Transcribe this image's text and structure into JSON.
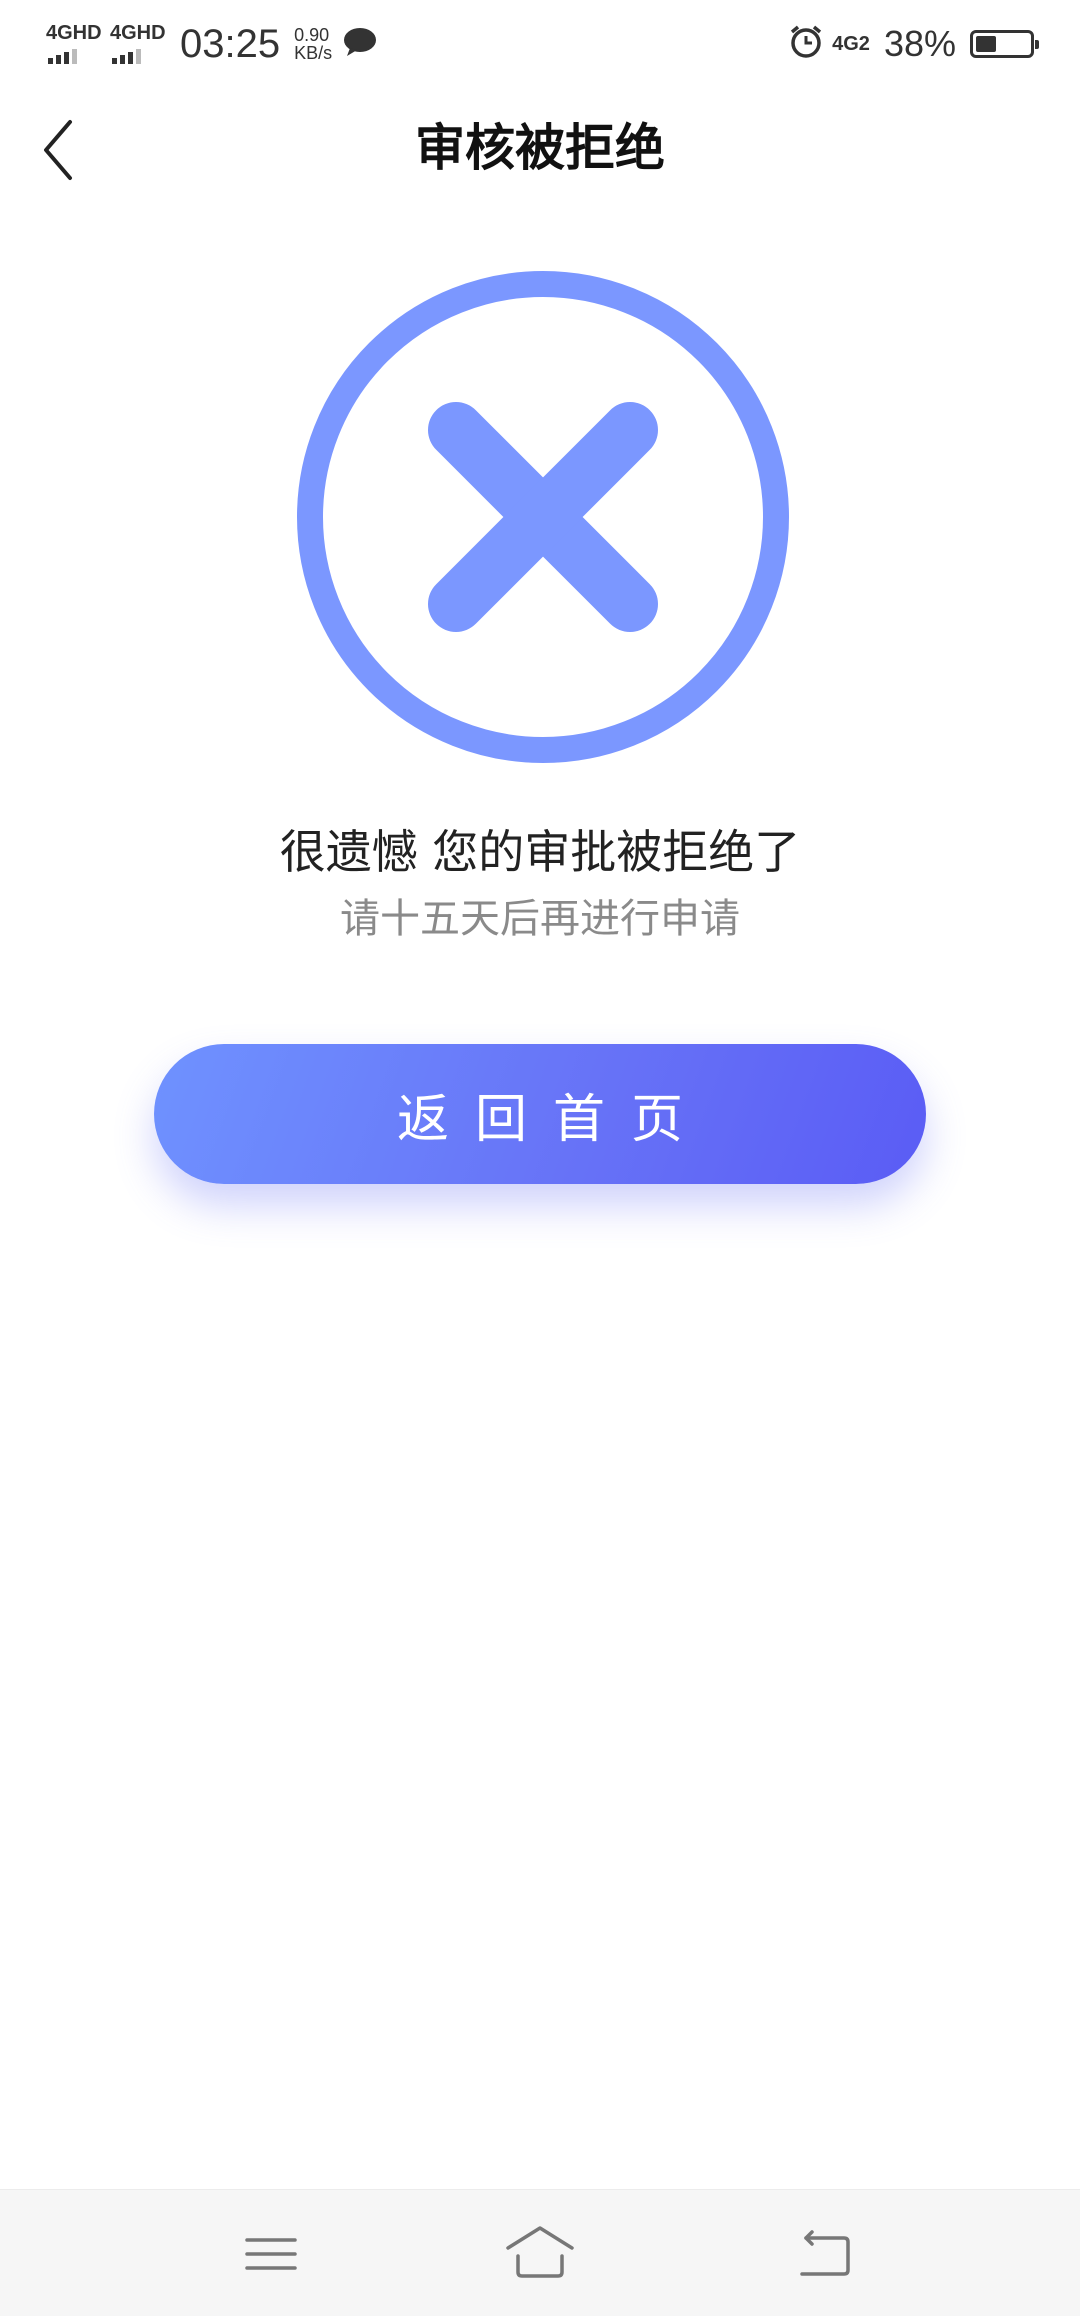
{
  "status_bar": {
    "signal1": "4GHD",
    "signal2": "4GHD",
    "time": "03:25",
    "speed_value": "0.90",
    "speed_unit": "KB/s",
    "network2": "4G2",
    "battery_percent": "38%",
    "battery_level": 0.38
  },
  "header": {
    "title": "审核被拒绝",
    "back_icon": "chevron-left-icon"
  },
  "result": {
    "icon": "reject-x-circle-icon",
    "icon_color": "#7b97ff",
    "message": "很遗憾 您的审批被拒绝了",
    "sub_message": "请十五天后再进行申请"
  },
  "actions": {
    "home_button_label": "返回首页"
  },
  "colors": {
    "button_gradient_start": "#6f92ff",
    "button_gradient_end": "#5a5cf5"
  },
  "nav_bar": {
    "items": [
      "menu-icon",
      "home-icon",
      "back-icon"
    ]
  }
}
